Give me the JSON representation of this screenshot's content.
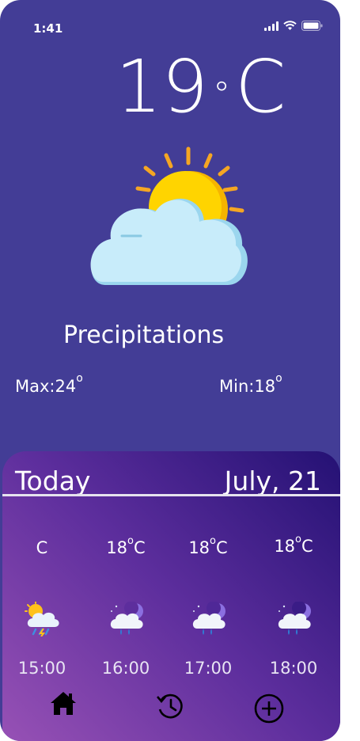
{
  "status": {
    "time": "1:41"
  },
  "current": {
    "temp_value": "19",
    "temp_degree": "°",
    "temp_unit": "C",
    "condition": "Precipitations",
    "max_label": "Max:24",
    "max_sup": "o",
    "min_label": "Min:18",
    "min_sup": "o"
  },
  "forecast": {
    "title": "Today",
    "date": "July, 21",
    "hours": [
      {
        "temp": "",
        "unit": "C",
        "time": "15:00",
        "icon": "sun-cloud-rain-icon"
      },
      {
        "temp": "18",
        "unit": "C",
        "time": "16:00",
        "icon": "moon-cloud-rain-icon"
      },
      {
        "temp": "18",
        "unit": "C",
        "time": "17:00",
        "icon": "moon-cloud-rain-icon"
      },
      {
        "temp": "18",
        "unit": "C",
        "time": "18:00",
        "icon": "moon-cloud-rain-icon"
      }
    ],
    "deg_sup": "o"
  },
  "nav": {
    "items": [
      "home-icon",
      "history-icon",
      "add-icon"
    ]
  }
}
